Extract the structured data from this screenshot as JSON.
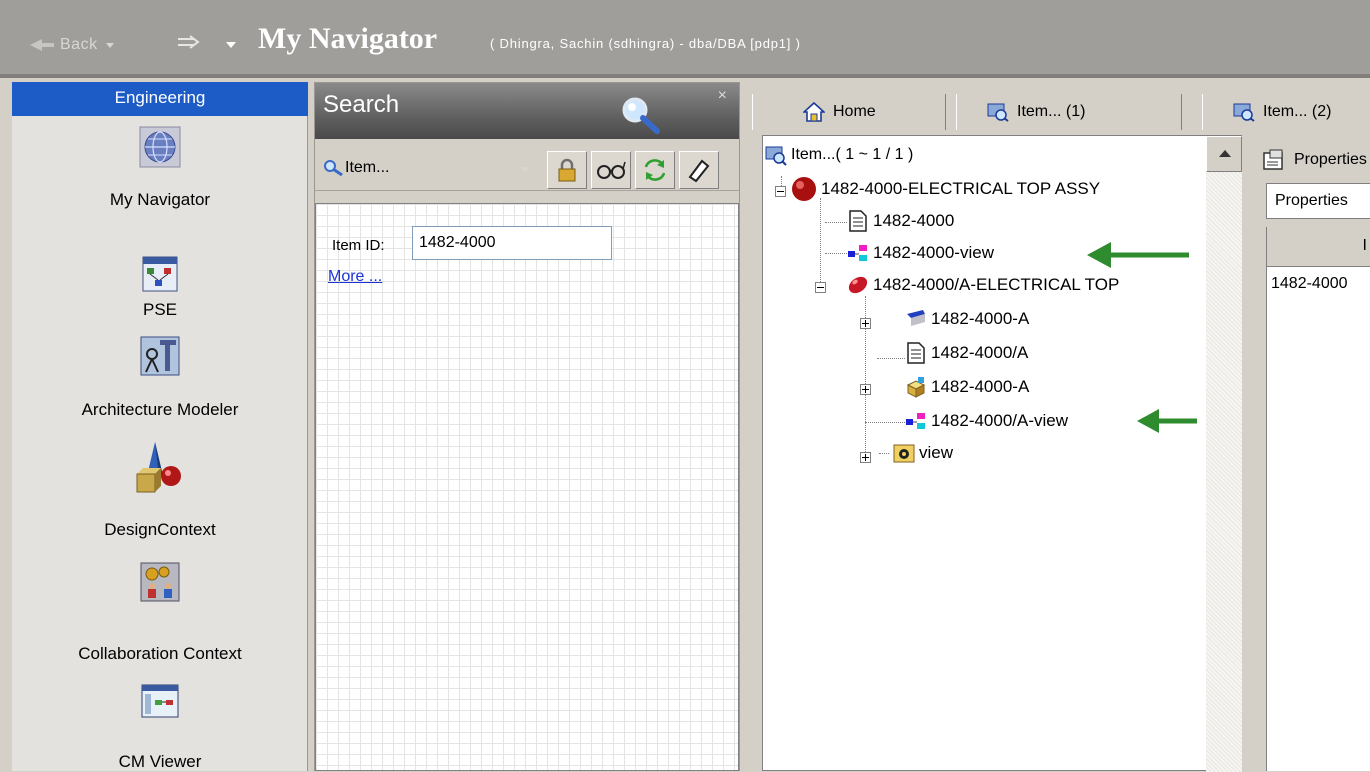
{
  "titlebar": {
    "back_label": "Back",
    "title": "My Navigator",
    "user_info": "( Dhingra, Sachin (sdhingra) - dba/DBA   [pdp1] )"
  },
  "sidebar": {
    "group": "Engineering",
    "apps": [
      {
        "label": "My Navigator",
        "icon": "globe-icon"
      },
      {
        "label": "PSE",
        "icon": "structure-icon"
      },
      {
        "label": "Architecture Modeler",
        "icon": "architecture-icon"
      },
      {
        "label": "DesignContext",
        "icon": "shapes-icon"
      },
      {
        "label": "Collaboration Context",
        "icon": "collaboration-icon"
      },
      {
        "label": "CM Viewer",
        "icon": "cm-viewer-icon"
      }
    ]
  },
  "search": {
    "title": "Search",
    "close": "×",
    "query_type": "Item...",
    "field_label": "Item ID:",
    "field_value": "1482-4000",
    "more_link": "More ..."
  },
  "tabs": [
    {
      "label": "Home",
      "icon": "home-icon"
    },
    {
      "label": "Item... (1)",
      "icon": "item-search-icon"
    },
    {
      "label": "Item... (2)",
      "icon": "item-search-icon"
    }
  ],
  "tree": {
    "root": "Item...( 1 ~ 1 / 1 )",
    "nodes": [
      "1482-4000-ELECTRICAL TOP ASSY",
      "1482-4000",
      "1482-4000-view",
      "1482-4000/A-ELECTRICAL TOP",
      "1482-4000-A",
      "1482-4000/A",
      "1482-4000-A",
      "1482-4000/A-view",
      "view"
    ]
  },
  "properties": {
    "header": "Properties",
    "tab": "Properties",
    "column": "I",
    "cell": "1482-4000"
  },
  "colors": {
    "accent_blue": "#1d5bc6",
    "arrow_green": "#2e8b2e",
    "link_blue": "#1a34d8"
  }
}
